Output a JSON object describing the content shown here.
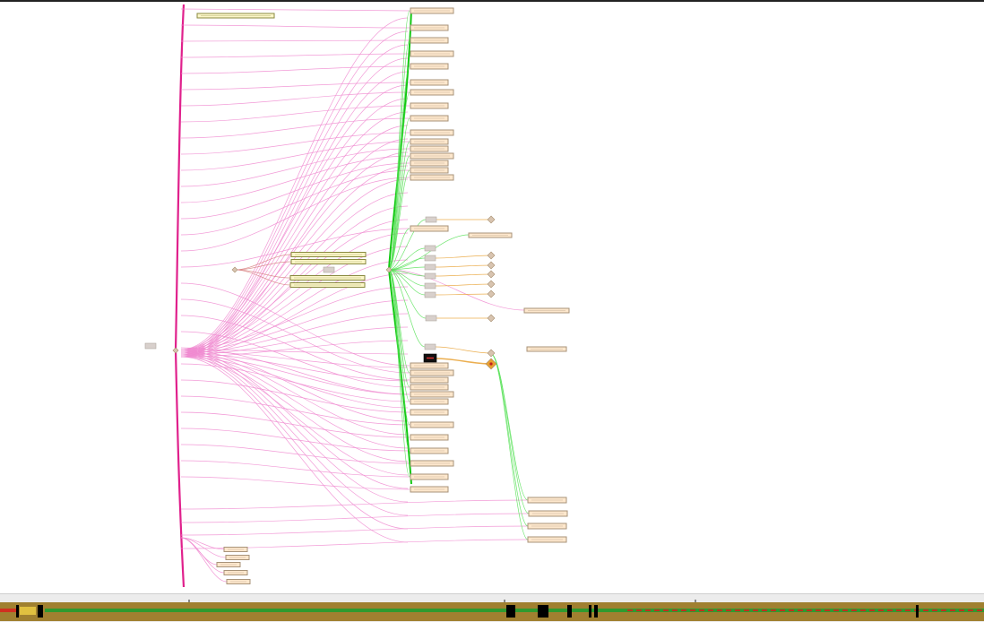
{
  "graph_view": {
    "colors": {
      "pink_edge": "#f08ad0",
      "pink_trunk": "#e0208c",
      "green_edge": "#55e055",
      "green_trunk": "#12c812",
      "orange_edge": "#e8a030",
      "node_fill": "#fde7cc",
      "node_border": "#a8937a",
      "yellow_node_fill": "#fbf6c8",
      "yellow_node_border": "#8a8a40",
      "grey_node": "#d8d0cc",
      "diamond": "#d8c4b0",
      "highlight_node": "#111111",
      "highlight_diamond": "#e8a030"
    },
    "icons": [
      "collapsed-node-icon",
      "diamond-junction-icon",
      "selected-node-icon"
    ]
  },
  "timeline": {
    "colors": {
      "track_bg": "#a08030",
      "track_line": "#2f9a2f",
      "dash": "#c03020",
      "marker": "#000000"
    }
  }
}
